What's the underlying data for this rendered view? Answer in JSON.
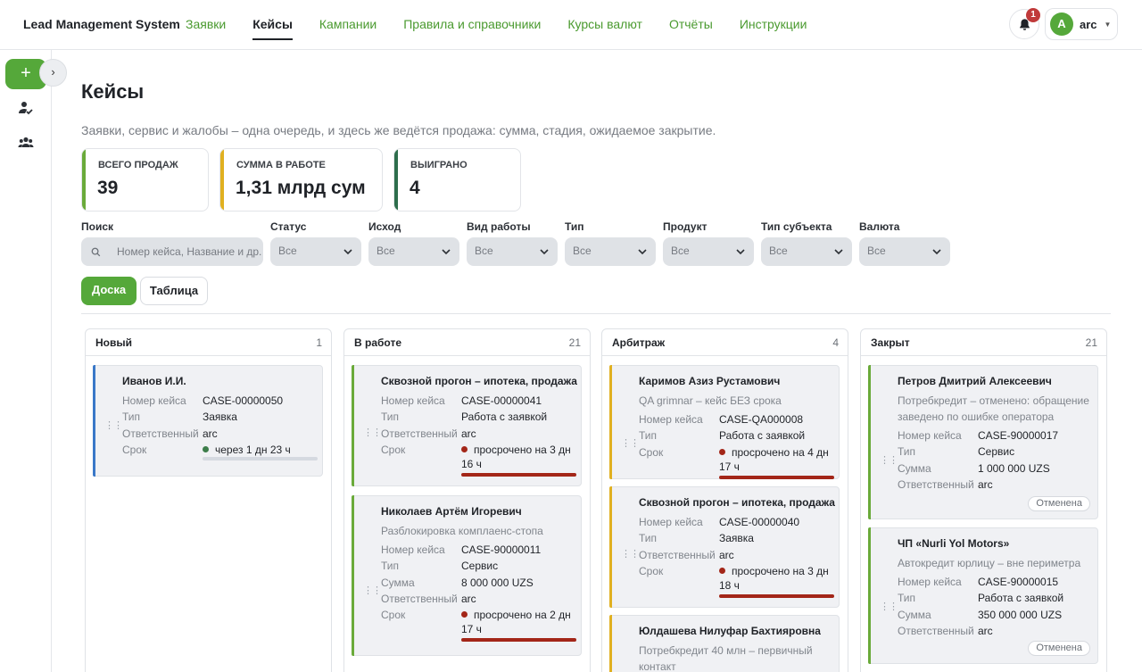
{
  "app": {
    "title": "Lead Management System"
  },
  "nav": [
    {
      "label": "Заявки",
      "active": false
    },
    {
      "label": "Кейсы",
      "active": true
    },
    {
      "label": "Кампании",
      "active": false
    },
    {
      "label": "Правила и справочники",
      "active": false
    },
    {
      "label": "Курсы валют",
      "active": false
    },
    {
      "label": "Отчёты",
      "active": false
    },
    {
      "label": "Инструкции",
      "active": false
    }
  ],
  "notifications": {
    "count": "1"
  },
  "user": {
    "initial": "A",
    "name": "arc"
  },
  "sidebar": {
    "add": "+",
    "collapse": "›",
    "icons": [
      "user-check-icon",
      "users-icon"
    ]
  },
  "page": {
    "title": "Кейсы",
    "subtitle": "Заявки, сервис и жалобы – одна очередь, и здесь же ведётся продажа: сумма, стадия, ожидаемое закрытие."
  },
  "stats": [
    {
      "label": "ВСЕГО ПРОДАЖ",
      "value": "39",
      "color": "#6aaa3a"
    },
    {
      "label": "СУММА В РАБОТЕ",
      "value": "1,31 млрд сум",
      "color": "#e0b020"
    },
    {
      "label": "ВЫИГРАНО",
      "value": "4",
      "color": "#2e6e4c"
    }
  ],
  "filters": {
    "search": {
      "label": "Поиск",
      "placeholder": "Номер кейса, Название и др."
    },
    "selects": [
      {
        "label": "Статус",
        "value": "Все"
      },
      {
        "label": "Исход",
        "value": "Все"
      },
      {
        "label": "Вид работы",
        "value": "Все"
      },
      {
        "label": "Тип",
        "value": "Все"
      },
      {
        "label": "Продукт",
        "value": "Все"
      },
      {
        "label": "Тип субъекта",
        "value": "Все"
      },
      {
        "label": "Валюта",
        "value": "Все"
      }
    ]
  },
  "views": {
    "board": "Доска",
    "table": "Таблица",
    "active": "board"
  },
  "columns": [
    {
      "title": "Новый",
      "count": "1",
      "cards": [
        {
          "title": "Иванов И.И.",
          "accent": "#3a78c8",
          "rows": [
            {
              "k": "Номер кейса",
              "v": "CASE-00000050"
            },
            {
              "k": "Тип",
              "v": "Заявка"
            },
            {
              "k": "Ответственный",
              "v": "arc"
            },
            {
              "k": "Срок",
              "v": "через 1 дн 23 ч",
              "dot": "green"
            }
          ],
          "progress": 0.01
        }
      ]
    },
    {
      "title": "В работе",
      "count": "21",
      "cards": [
        {
          "title": "Сквозной прогон – ипотека, продажа",
          "accent": "#6aaa3a",
          "rows": [
            {
              "k": "Номер кейса",
              "v": "CASE-00000041"
            },
            {
              "k": "Тип",
              "v": "Работа с заявкой"
            },
            {
              "k": "Ответственный",
              "v": "arc"
            },
            {
              "k": "Срок",
              "v": "просрочено на 3 дн 16 ч",
              "dot": "red"
            }
          ],
          "progress": 1
        },
        {
          "title": "Николаев Артём Игоревич",
          "subtitle": "Разблокировка комплаенс-стопа",
          "accent": "#6aaa3a",
          "rows": [
            {
              "k": "Номер кейса",
              "v": "CASE-90000011"
            },
            {
              "k": "Тип",
              "v": "Сервис"
            },
            {
              "k": "Сумма",
              "v": "8 000 000 UZS"
            },
            {
              "k": "Ответственный",
              "v": "arc"
            },
            {
              "k": "Срок",
              "v": "просрочено на 2 дн 17 ч",
              "dot": "red"
            }
          ],
          "progress": 1
        }
      ]
    },
    {
      "title": "Арбитраж",
      "count": "4",
      "cards": [
        {
          "title": "Каримов Азиз Рустамович",
          "subtitle": "QA grimnar – кейс БЕЗ срока",
          "accent": "#e0b020",
          "rows": [
            {
              "k": "Номер кейса",
              "v": "CASE-QA000008"
            },
            {
              "k": "Тип",
              "v": "Работа с заявкой"
            },
            {
              "k": "Срок",
              "v": "просрочено на 4 дн 17 ч",
              "dot": "red"
            }
          ],
          "progress": 1
        },
        {
          "title": "Сквозной прогон – ипотека, продажа",
          "accent": "#e0b020",
          "rows": [
            {
              "k": "Номер кейса",
              "v": "CASE-00000040"
            },
            {
              "k": "Тип",
              "v": "Заявка"
            },
            {
              "k": "Ответственный",
              "v": "arc"
            },
            {
              "k": "Срок",
              "v": "просрочено на 3 дн 18 ч",
              "dot": "red"
            }
          ],
          "progress": 1
        },
        {
          "title": "Юлдашева Нилуфар Бахтияровна",
          "subtitle": "Потребкредит 40 млн – первичный контакт",
          "accent": "#e0b020",
          "rows": []
        }
      ]
    },
    {
      "title": "Закрыт",
      "count": "21",
      "cards": [
        {
          "title": "Петров Дмитрий Алексеевич",
          "subtitle": "Потребкредит – отменено: обращение заведено по ошибке оператора",
          "accent": "#6aaa3a",
          "rows": [
            {
              "k": "Номер кейса",
              "v": "CASE-90000017"
            },
            {
              "k": "Тип",
              "v": "Сервис"
            },
            {
              "k": "Сумма",
              "v": "1 000 000 UZS"
            },
            {
              "k": "Ответственный",
              "v": "arc"
            }
          ],
          "badge": "Отменена"
        },
        {
          "title": "ЧП «Nurli Yol Motors»",
          "subtitle": "Автокредит юрлицу – вне периметра",
          "accent": "#6aaa3a",
          "rows": [
            {
              "k": "Номер кейса",
              "v": "CASE-90000015"
            },
            {
              "k": "Тип",
              "v": "Работа с заявкой"
            },
            {
              "k": "Сумма",
              "v": "350 000 000 UZS"
            },
            {
              "k": "Ответственный",
              "v": "arc"
            }
          ],
          "badge": "Отменена"
        }
      ]
    }
  ]
}
